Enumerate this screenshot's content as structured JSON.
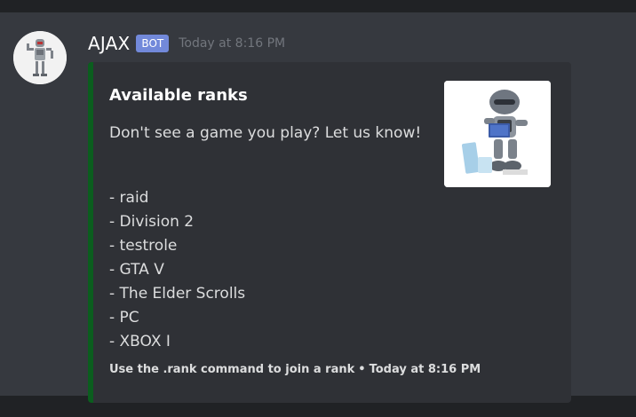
{
  "message": {
    "author": "AJAX",
    "bot_tag": "BOT",
    "timestamp": "Today at 8:16 PM",
    "avatar_icon": "robot-avatar-icon"
  },
  "embed": {
    "accent_color": "#0b5d1e",
    "title": "Available ranks",
    "description": "Don't see a game you play? Let us know!",
    "ranks": [
      "- raid",
      "- Division 2",
      "- testrole",
      "- GTA V",
      "- The Elder Scrolls",
      "- PC",
      "- XBOX I"
    ],
    "footer_text": "Use the .rank command to join a rank",
    "footer_separator": "•",
    "footer_timestamp": "Today at 8:16 PM",
    "thumbnail_icon": "robot-reading-thumbnail"
  }
}
